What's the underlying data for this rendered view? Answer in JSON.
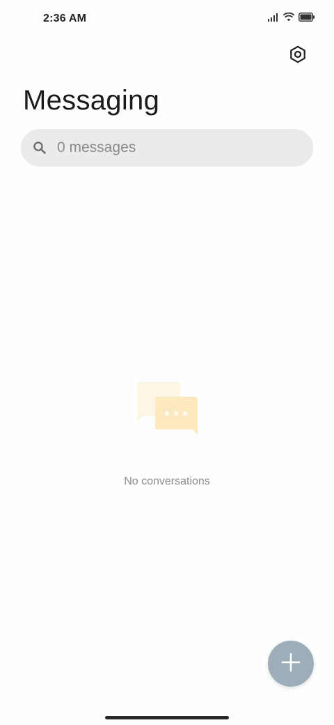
{
  "status_bar": {
    "time": "2:36 AM",
    "icons": [
      "signal-icon",
      "wifi-icon",
      "battery-icon"
    ]
  },
  "header": {
    "settings_icon": "settings-icon",
    "title": "Messaging"
  },
  "search": {
    "icon": "search-icon",
    "placeholder": "0 messages"
  },
  "empty_state": {
    "illustration": "chat-bubbles-icon",
    "message": "No conversations"
  },
  "fab": {
    "icon": "plus-icon"
  },
  "colors": {
    "background": "#fdfefe",
    "search_bar": "#ebebeb",
    "fab": "#9daeba",
    "illustration_back": "#fdf6e6",
    "illustration_front": "#fde9bf"
  }
}
